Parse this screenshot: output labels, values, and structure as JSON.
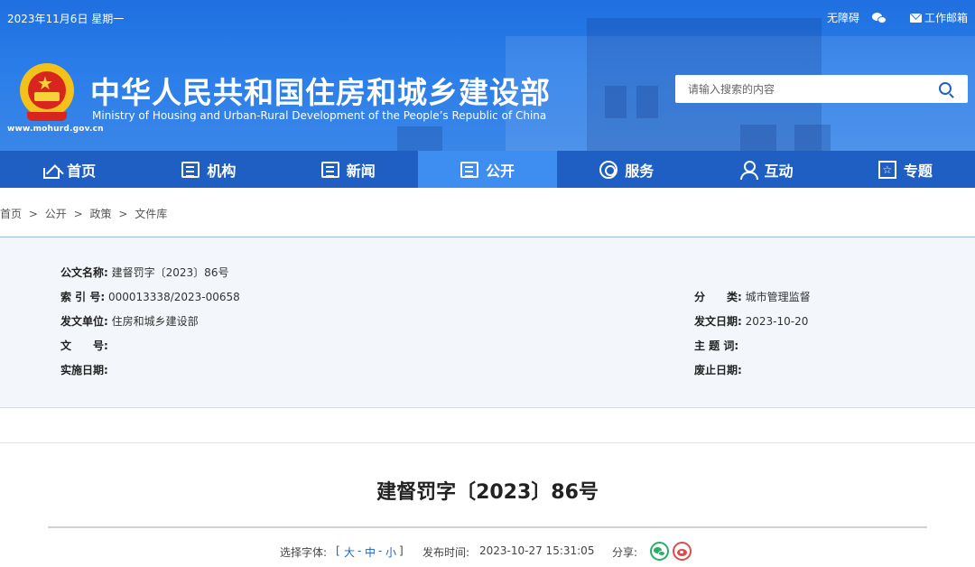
{
  "topbar": {
    "date": "2023年11月6日 星期一",
    "accessibility": "无障碍",
    "wechat_icon": "wechat-icon",
    "mail_label": "工作邮箱"
  },
  "site": {
    "title": "中华人民共和国住房和城乡建设部",
    "subtitle": "Ministry of Housing and Urban-Rural Development of the People’s Republic of China",
    "url": "www.mohurd.gov.cn"
  },
  "search": {
    "placeholder": "请输入搜索的内容"
  },
  "nav": {
    "items": [
      {
        "label": "首页",
        "icon": "home-icon"
      },
      {
        "label": "机构",
        "icon": "building-icon"
      },
      {
        "label": "新闻",
        "icon": "news-icon"
      },
      {
        "label": "公开",
        "icon": "open-icon"
      },
      {
        "label": "服务",
        "icon": "service-icon"
      },
      {
        "label": "互动",
        "icon": "interaction-icon"
      },
      {
        "label": "专题",
        "icon": "topic-star-icon"
      }
    ],
    "active": "公开",
    "colors": {
      "bar": "#1f5fc4",
      "active": "#3e8ef2"
    }
  },
  "breadcrumb": [
    "首页",
    ">",
    "公开",
    ">",
    "政策",
    ">",
    "文件库"
  ],
  "info": {
    "title_label": "公文名称:",
    "title_value": "建督罚字〔2023〕86号",
    "index_label": "索 引 号:",
    "index_value": "000013338/2023-00658",
    "category_label": "分　　类:",
    "category_value": "城市管理监督",
    "issuer_label": "发文单位:",
    "issuer_value": "住房和城乡建设部",
    "date_label": "发文日期:",
    "date_value": "2023-10-20",
    "docno_label": "文　　号:",
    "docno_value": "",
    "keywords_label": "主 题 词:",
    "keywords_value": "",
    "effective_label": "实施日期:",
    "effective_value": "",
    "expire_label": "废止日期:",
    "expire_value": ""
  },
  "document": {
    "title": "建督罚字〔2023〕86号"
  },
  "meta": {
    "font_label": "选择字体:",
    "bracket_open": "[",
    "font_large": "大",
    "dash1": "-",
    "font_medium": "中",
    "dash2": "-",
    "font_small": "小",
    "bracket_close": "]",
    "publish_label": "发布时间:",
    "publish_time": "2023-10-27 15:31:05",
    "share_label": "分享:"
  }
}
